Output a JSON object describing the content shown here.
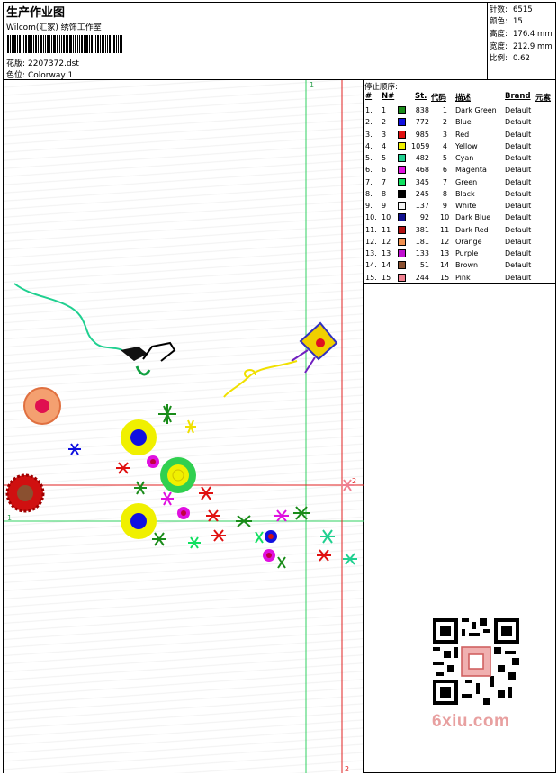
{
  "header": {
    "title": "生产作业图",
    "subtitle": "Wilcom(汇家) 绣饰工作室",
    "design_label": "花版:",
    "design_value": "2207372.dst",
    "colorway_label": "色位:",
    "colorway_value": "Colorway 1"
  },
  "stats": [
    {
      "label": "针数:",
      "value": "6515"
    },
    {
      "label": "颜色:",
      "value": "15"
    },
    {
      "label": "高度:",
      "value": "176.4 mm"
    },
    {
      "label": "宽度:",
      "value": "212.9 mm"
    },
    {
      "label": "比例:",
      "value": "0.62"
    }
  ],
  "stop_sequence": {
    "title": "停止顺序:",
    "headers": {
      "hash": "#",
      "num": "N#",
      "st": "St.",
      "code": "代码",
      "desc": "描述",
      "brand": "Brand",
      "element": "元素"
    },
    "rows": [
      {
        "idx": "1.",
        "n": "1",
        "color": "#1a8c1a",
        "st": "838",
        "code": "1",
        "desc": "Dark Green",
        "brand": "Default"
      },
      {
        "idx": "2.",
        "n": "2",
        "color": "#1010e0",
        "st": "772",
        "code": "2",
        "desc": "Blue",
        "brand": "Default"
      },
      {
        "idx": "3.",
        "n": "3",
        "color": "#e01010",
        "st": "985",
        "code": "3",
        "desc": "Red",
        "brand": "Default"
      },
      {
        "idx": "4.",
        "n": "4",
        "color": "#f0f000",
        "st": "1059",
        "code": "4",
        "desc": "Yellow",
        "brand": "Default"
      },
      {
        "idx": "5.",
        "n": "5",
        "color": "#20d090",
        "st": "482",
        "code": "5",
        "desc": "Cyan",
        "brand": "Default"
      },
      {
        "idx": "6.",
        "n": "6",
        "color": "#e010e0",
        "st": "468",
        "code": "6",
        "desc": "Magenta",
        "brand": "Default"
      },
      {
        "idx": "7.",
        "n": "7",
        "color": "#10e060",
        "st": "345",
        "code": "7",
        "desc": "Green",
        "brand": "Default"
      },
      {
        "idx": "8.",
        "n": "8",
        "color": "#000000",
        "st": "245",
        "code": "8",
        "desc": "Black",
        "brand": "Default"
      },
      {
        "idx": "9.",
        "n": "9",
        "color": "#f4f4f4",
        "st": "137",
        "code": "9",
        "desc": "White",
        "brand": "Default"
      },
      {
        "idx": "10.",
        "n": "10",
        "color": "#101090",
        "st": "92",
        "code": "10",
        "desc": "Dark Blue",
        "brand": "Default"
      },
      {
        "idx": "11.",
        "n": "11",
        "color": "#b01010",
        "st": "381",
        "code": "11",
        "desc": "Dark Red",
        "brand": "Default"
      },
      {
        "idx": "12.",
        "n": "12",
        "color": "#f09050",
        "st": "181",
        "code": "12",
        "desc": "Orange",
        "brand": "Default"
      },
      {
        "idx": "13.",
        "n": "13",
        "color": "#c010d0",
        "st": "133",
        "code": "13",
        "desc": "Purple",
        "brand": "Default"
      },
      {
        "idx": "14.",
        "n": "14",
        "color": "#8a5030",
        "st": "51",
        "code": "14",
        "desc": "Brown",
        "brand": "Default"
      },
      {
        "idx": "15.",
        "n": "15",
        "color": "#f08090",
        "st": "244",
        "code": "15",
        "desc": "Pink",
        "brand": "Default"
      }
    ]
  },
  "guides": {
    "green_label_top": "1",
    "green_label_left": "1",
    "red_label_right": "2",
    "red_label_bottom": "2"
  },
  "watermark": {
    "site": "6xiu.com"
  }
}
